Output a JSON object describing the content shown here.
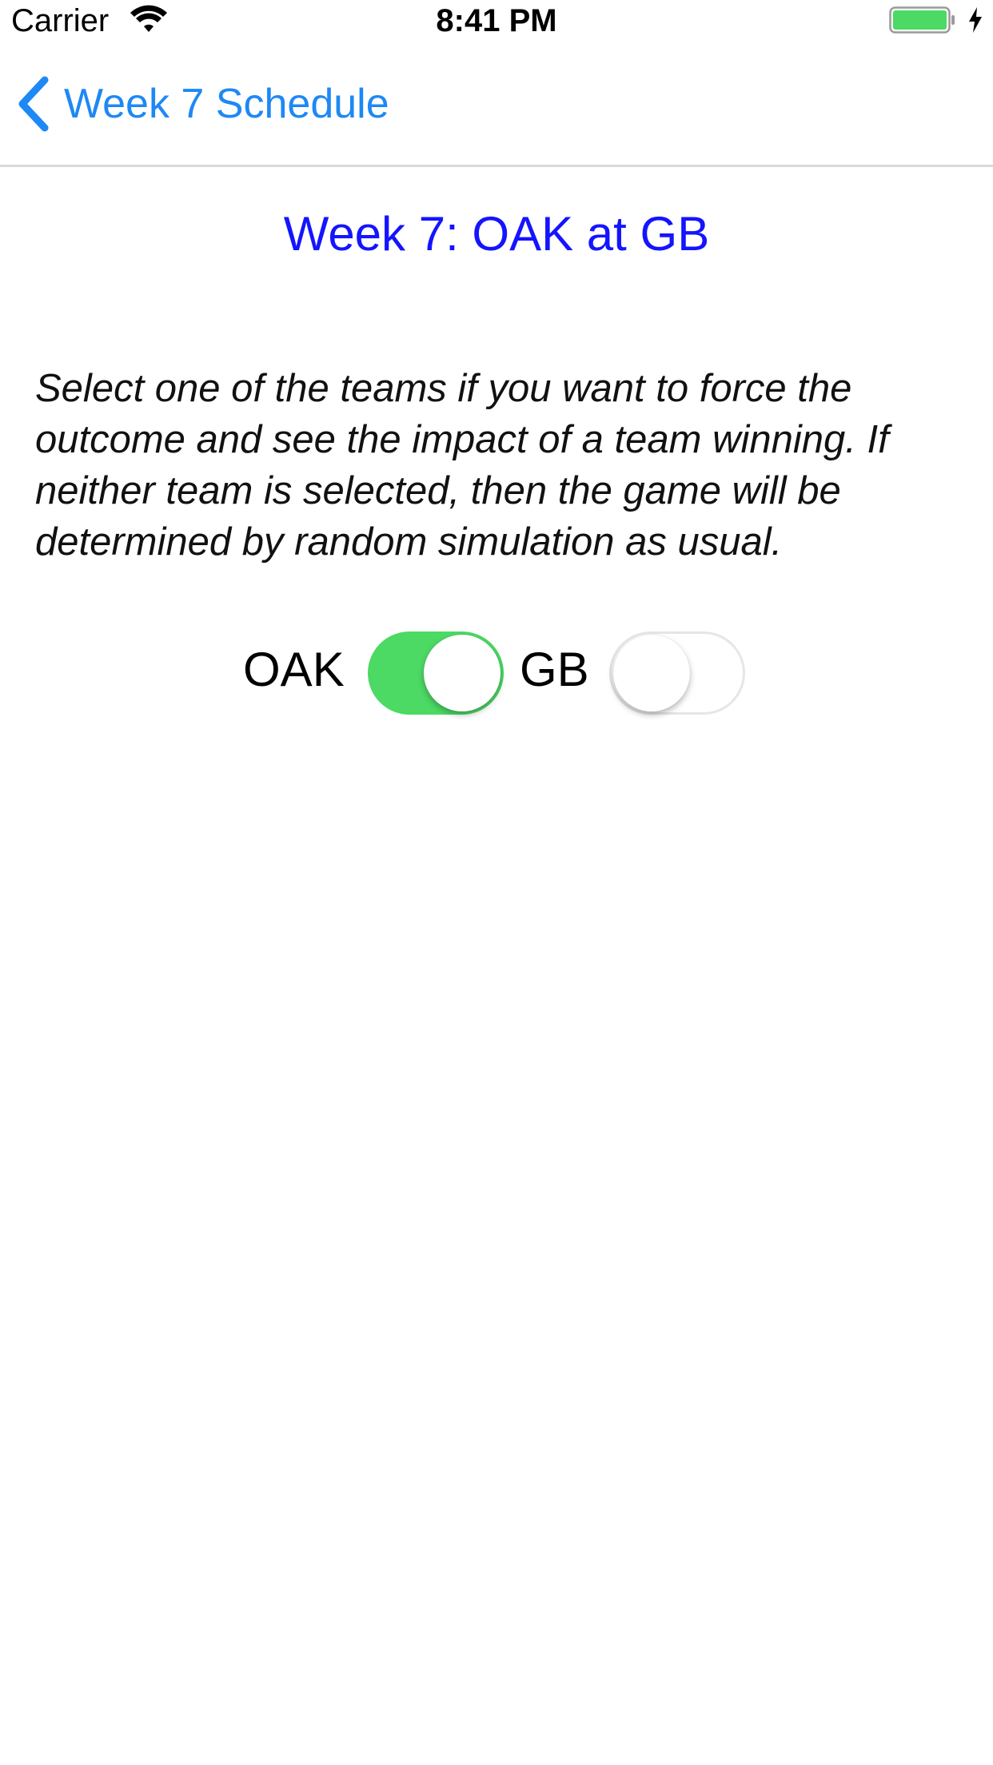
{
  "status_bar": {
    "carrier": "Carrier",
    "time": "8:41 PM",
    "battery_color": "#4cd964"
  },
  "nav": {
    "back_label": "Week 7 Schedule",
    "tint_color": "#1e88f5"
  },
  "game": {
    "title": "Week 7: OAK at GB",
    "title_color": "#1414ff",
    "instructions": "Select one of the teams if you want to force the outcome and see the impact  of a team winning. If neither team is selected, then the game will be determined by random simulation as usual."
  },
  "teams": [
    {
      "label": "OAK",
      "selected": true
    },
    {
      "label": "GB",
      "selected": false
    }
  ],
  "colors": {
    "switch_on": "#4cd964",
    "switch_off_border": "#e6e6e6"
  }
}
